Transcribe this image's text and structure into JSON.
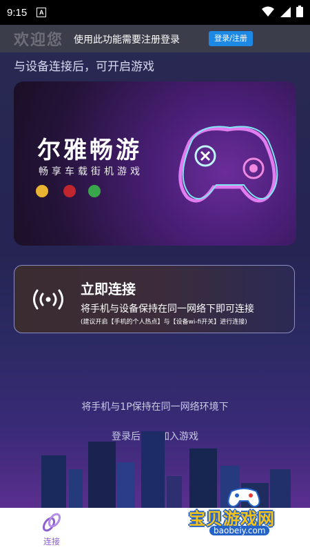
{
  "status_bar": {
    "time": "9:15",
    "a_icon": "A",
    "icons": [
      "wifi-icon",
      "signal-icon",
      "battery-icon"
    ]
  },
  "banner": {
    "welcome": "欢迎您",
    "message": "使用此功能需要注册登录",
    "login_label": "登录/注册"
  },
  "subtitle": "与设备连接后，可开启游戏",
  "game_card": {
    "title": "尔雅畅游",
    "slogan": "畅享车载街机游戏"
  },
  "connect_card": {
    "title": "立即连接",
    "description": "将手机与设备保持在同一网络下即可连接",
    "note": "(建议开启【手机的个人热点】与【设备wi-fi开关】进行连接)"
  },
  "hint_network": "将手机与1P保持在同一网络环境下",
  "hint_login": "登录后即可加入游戏",
  "bottom_nav": {
    "connect_label": "连接"
  },
  "watermark": {
    "title": "宝贝游戏网",
    "url": "baobeiy.com"
  },
  "colors": {
    "accent_blue": "#1e88e5",
    "nav_purple": "#8e5fd0",
    "watermark_yellow": "#f5c218"
  }
}
